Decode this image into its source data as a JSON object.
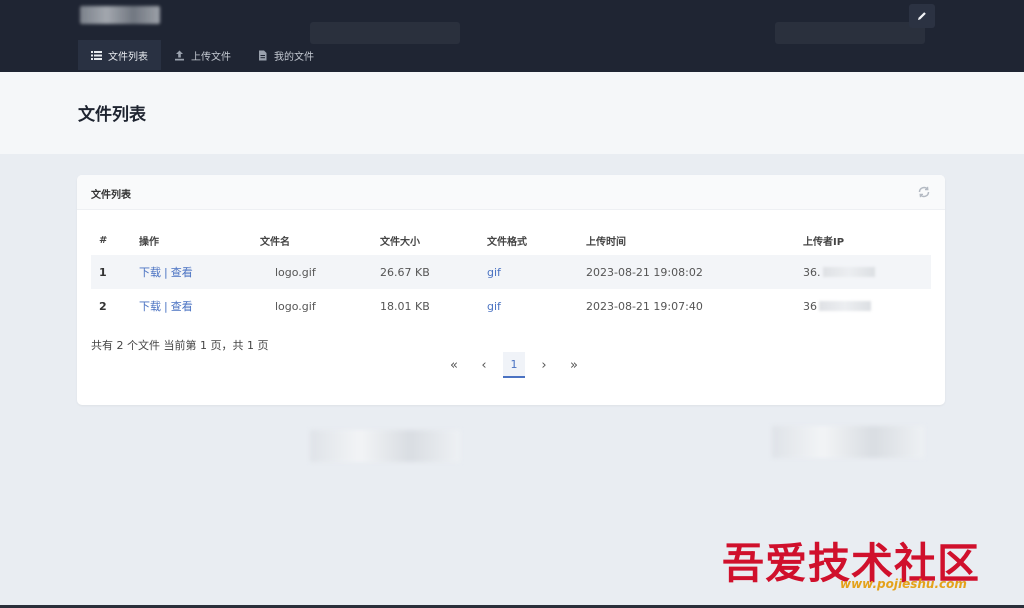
{
  "header": {
    "nav": [
      {
        "label": "文件列表",
        "icon": "list-icon",
        "active": true
      },
      {
        "label": "上传文件",
        "icon": "upload-icon",
        "active": false
      },
      {
        "label": "我的文件",
        "icon": "file-icon",
        "active": false
      }
    ],
    "edit_icon": "pencil-icon"
  },
  "page": {
    "title": "文件列表"
  },
  "card": {
    "title": "文件列表",
    "refresh_icon": "refresh-icon",
    "columns": [
      "#",
      "操作",
      "文件名",
      "文件大小",
      "文件格式",
      "上传时间",
      "上传者IP"
    ],
    "rows": [
      {
        "num": "1",
        "download": "下载",
        "sep": "|",
        "view": "查看",
        "filename": "logo.gif",
        "size": "26.67 KB",
        "format": "gif",
        "time": "2023-08-21 19:08:02",
        "ip": "36."
      },
      {
        "num": "2",
        "download": "下载",
        "sep": "|",
        "view": "查看",
        "filename": "logo.gif",
        "size": "18.01 KB",
        "format": "gif",
        "time": "2023-08-21 19:07:40",
        "ip": "36"
      }
    ],
    "summary": "共有 2 个文件  当前第 1 页，共 1 页",
    "pagination": {
      "first": "«",
      "prev": "‹",
      "current": "1",
      "next": "›",
      "last": "»"
    }
  },
  "watermark": {
    "text": "吾爱技术社区",
    "url": "www.pojieshu.com"
  },
  "colors": {
    "header_bg": "#1f2533",
    "link": "#4a72c2",
    "watermark": "#d0102c"
  }
}
